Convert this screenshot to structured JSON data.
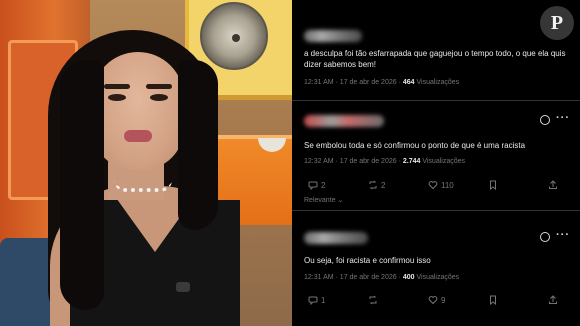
{
  "watermark": {
    "letter": "P",
    "icon": "brand-logo-icon"
  },
  "tweets": [
    {
      "text": "a desculpa foi tão esfarrapada que gaguejou o tempo todo, o que ela quis dizer sabemos bem!",
      "time": "12:31 AM · 17 de abr de 2026 · ",
      "views": "464",
      "views_label": " Visualizações"
    },
    {
      "text": "Se embolou toda e só confirmou o ponto de que é uma racista",
      "time": "12:32 AM · 17 de abr de 2026 · ",
      "views": "2.744",
      "views_label": " Visualizações",
      "replies": "2",
      "retweets": "2",
      "likes": "110",
      "sort_label": "Relevante"
    },
    {
      "text": "Ou seja, foi racista e confirmou isso",
      "time": "12:31 AM · 17 de abr de 2026 · ",
      "views": "400",
      "views_label": " Visualizações",
      "replies": "1",
      "likes": "9"
    }
  ],
  "colors": {
    "text": "#e7e9ea",
    "muted": "#71767b",
    "divider": "#2f3336"
  }
}
